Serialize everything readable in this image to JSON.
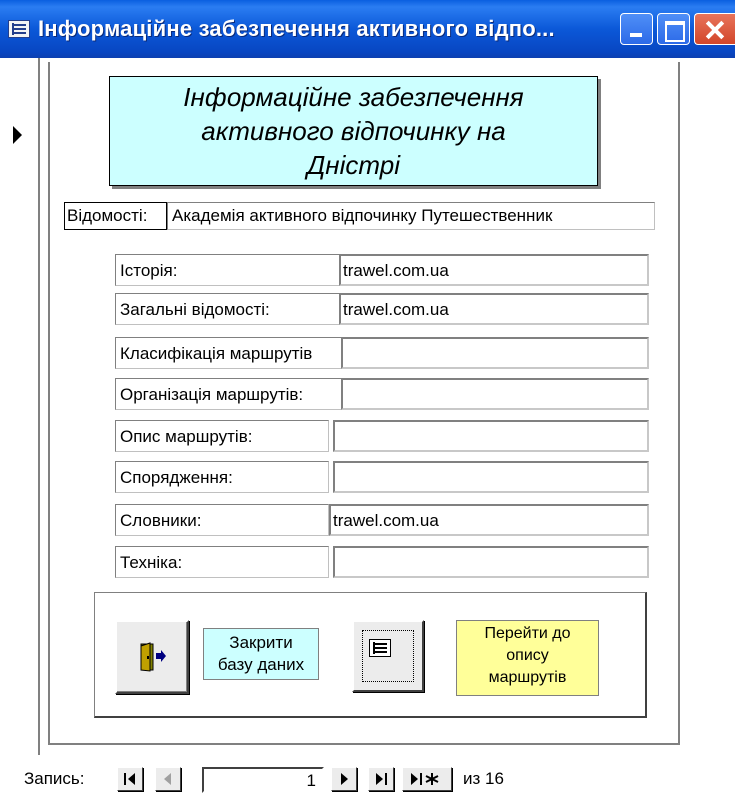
{
  "window": {
    "title": "Інформаційне забезпечення активного відпо..."
  },
  "heading": "Інформаційне забезпечення\nактивного відпочинку на\nДністрі",
  "vidomosti": {
    "label": "Відомості:",
    "value": "Академія активного відпочинку Путешественник"
  },
  "fields": [
    {
      "label": "Історія:",
      "value": "trawel.com.ua"
    },
    {
      "label": "Загальні відомості:",
      "value": "trawel.com.ua"
    },
    {
      "label": "Класифікація маршрутів",
      "value": ""
    },
    {
      "label": "Організація маршрутів:",
      "value": ""
    },
    {
      "label": "Опис маршрутів:",
      "value": ""
    },
    {
      "label": "Спорядження:",
      "value": ""
    },
    {
      "label": "Словники:",
      "value": "trawel.com.ua"
    },
    {
      "label": "Техніка:",
      "value": ""
    }
  ],
  "buttons": {
    "close_db_label": "Закрити\nбазу даних",
    "goto_routes_label": "Перейти до\nопису\nмаршрутів"
  },
  "navigation": {
    "record_label": "Запись:",
    "current_record": "1",
    "total_text": "из 16"
  },
  "colors": {
    "heading_bg": "#ccffff",
    "goto_bg": "#ffff99",
    "titlebar": "#0b58d8"
  }
}
